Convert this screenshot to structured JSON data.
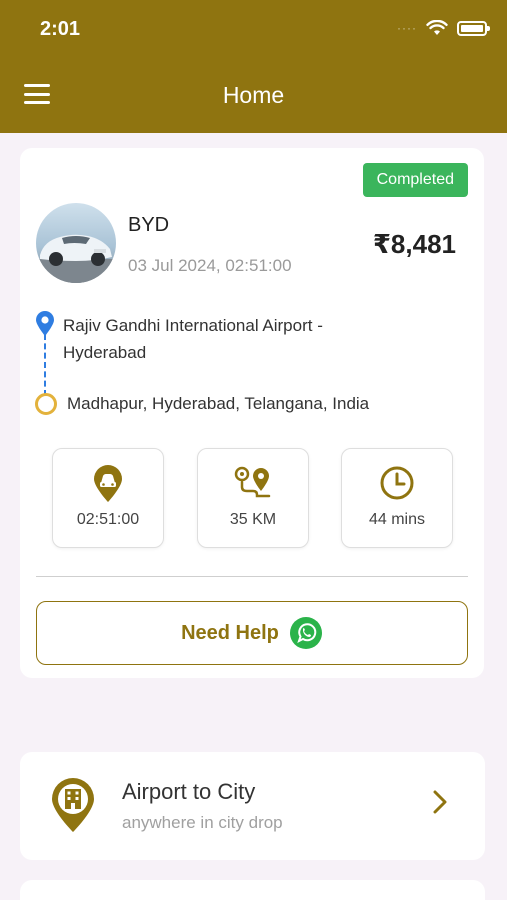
{
  "status_bar": {
    "time": "2:01",
    "signal_dots": "····"
  },
  "header": {
    "title": "Home"
  },
  "ride": {
    "status": "Completed",
    "car_name": "BYD",
    "datetime": "03 Jul 2024,  02:51:00",
    "fare": "₹8,481",
    "pickup": "Rajiv Gandhi International Airport - Hyderabad",
    "drop": "Madhapur, Hyderabad, Telangana, India",
    "stats": [
      {
        "icon": "taxi-pin-icon",
        "value": "02:51:00"
      },
      {
        "icon": "route-icon",
        "value": "35 KM"
      },
      {
        "icon": "clock-icon",
        "value": "44 mins"
      }
    ],
    "help_label": "Need Help"
  },
  "services": [
    {
      "title": "Airport to City",
      "subtitle": "anywhere in city drop",
      "icon": "building-pin-icon"
    }
  ],
  "colors": {
    "brand": "#8f7410",
    "completed": "#3bb55c",
    "pickup": "#2f7de1",
    "drop": "#e3b23c",
    "whatsapp": "#2bb34a"
  }
}
